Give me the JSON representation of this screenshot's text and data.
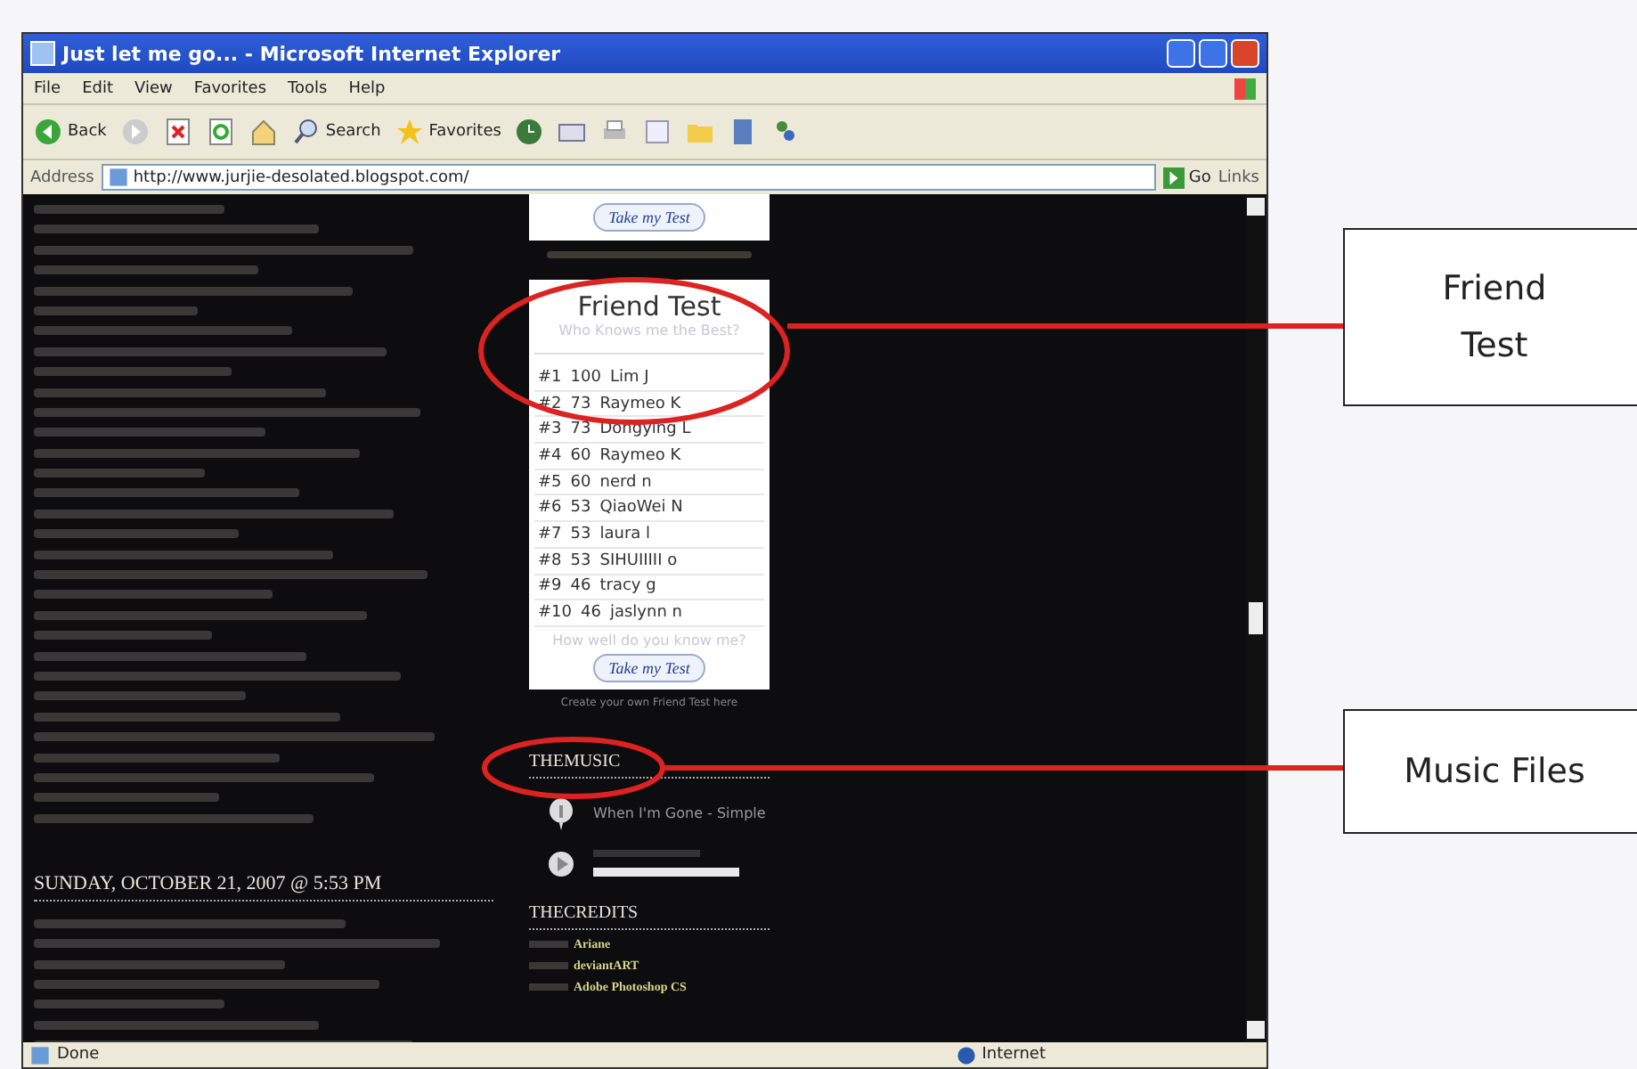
{
  "window": {
    "title": "Just let me go... - Microsoft Internet Explorer"
  },
  "menu": [
    "File",
    "Edit",
    "View",
    "Favorites",
    "Tools",
    "Help"
  ],
  "toolbar": {
    "back": "Back",
    "search": "Search",
    "favorites": "Favorites"
  },
  "address": {
    "label": "Address",
    "value": "http://www.jurjie-desolated.blogspot.com/",
    "go": "Go",
    "links": "Links"
  },
  "friend_test": {
    "top_button": "Take my Test",
    "title": "Friend Test",
    "subtitle": "Who Knows me the Best?",
    "ranking": [
      {
        "rank": "#1",
        "score": "100",
        "name": "Lim J"
      },
      {
        "rank": "#2",
        "score": "73",
        "name": "Raymeo K"
      },
      {
        "rank": "#3",
        "score": "73",
        "name": "Dongying L"
      },
      {
        "rank": "#4",
        "score": "60",
        "name": "Raymeo K"
      },
      {
        "rank": "#5",
        "score": "60",
        "name": "nerd n"
      },
      {
        "rank": "#6",
        "score": "53",
        "name": "QiaoWei N"
      },
      {
        "rank": "#7",
        "score": "53",
        "name": "laura l"
      },
      {
        "rank": "#8",
        "score": "53",
        "name": "SIHUIIIII o"
      },
      {
        "rank": "#9",
        "score": "46",
        "name": "tracy g"
      },
      {
        "rank": "#10",
        "score": "46",
        "name": "jaslynn n"
      }
    ],
    "question": "How well do you know me?",
    "button": "Take my Test",
    "footer": "Create your own Friend Test here"
  },
  "post": {
    "date": "SUNDAY, OCTOBER 21, 2007 @ 5:53 PM"
  },
  "music": {
    "heading": "THEMUSIC",
    "tracks": [
      {
        "title": "When I'm Gone - Simple"
      }
    ],
    "level": 1
  },
  "credits": {
    "heading": "THECREDITS",
    "values": [
      "Ariane",
      "deviantART",
      "Adobe Photoshop CS"
    ]
  },
  "status_bar": {
    "text": "Done",
    "zone": "Internet"
  },
  "callouts": [
    {
      "label": "Friend Test"
    },
    {
      "label": "Music Files"
    }
  ]
}
